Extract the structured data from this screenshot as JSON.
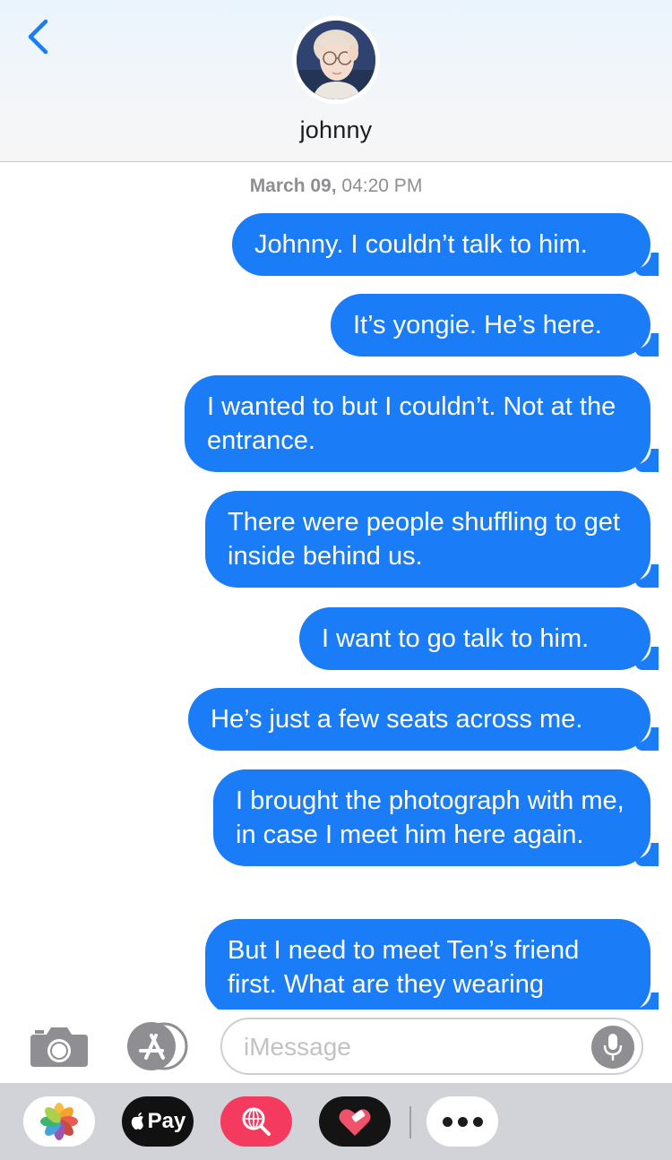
{
  "header": {
    "contact_name": "johnny",
    "back_label": "",
    "accent_color": "#1a7cf6"
  },
  "thread": {
    "timestamp_date": "March 09,",
    "timestamp_time": "04:20 PM",
    "messages": [
      {
        "text": "Johnny. I couldn’t talk to him.",
        "direction": "outgoing"
      },
      {
        "text": "It’s yongie. He’s here.",
        "direction": "outgoing"
      },
      {
        "text": "I wanted to but I couldn’t. Not at the entrance.",
        "direction": "outgoing"
      },
      {
        "text": "There were people shuffling to get inside behind us.",
        "direction": "outgoing"
      },
      {
        "text": "I want to go talk to him.",
        "direction": "outgoing"
      },
      {
        "text": "He’s just a few seats across me.",
        "direction": "outgoing"
      },
      {
        "text": "I brought the photograph with me, in case I meet him here again.",
        "direction": "outgoing"
      },
      {
        "text": "But I need to meet Ten’s friend first. What are they wearing",
        "direction": "outgoing"
      }
    ],
    "bubble_color": "#1a7cf6"
  },
  "input_bar": {
    "placeholder": "iMessage",
    "value": "",
    "icons": [
      "camera-icon",
      "app-store-icon",
      "microphone-icon"
    ]
  },
  "app_drawer": {
    "pay_label": "Pay",
    "apps": [
      "photos-icon",
      "apple-pay-icon",
      "image-search-icon",
      "heart-sticker-icon",
      "more-icon"
    ]
  }
}
